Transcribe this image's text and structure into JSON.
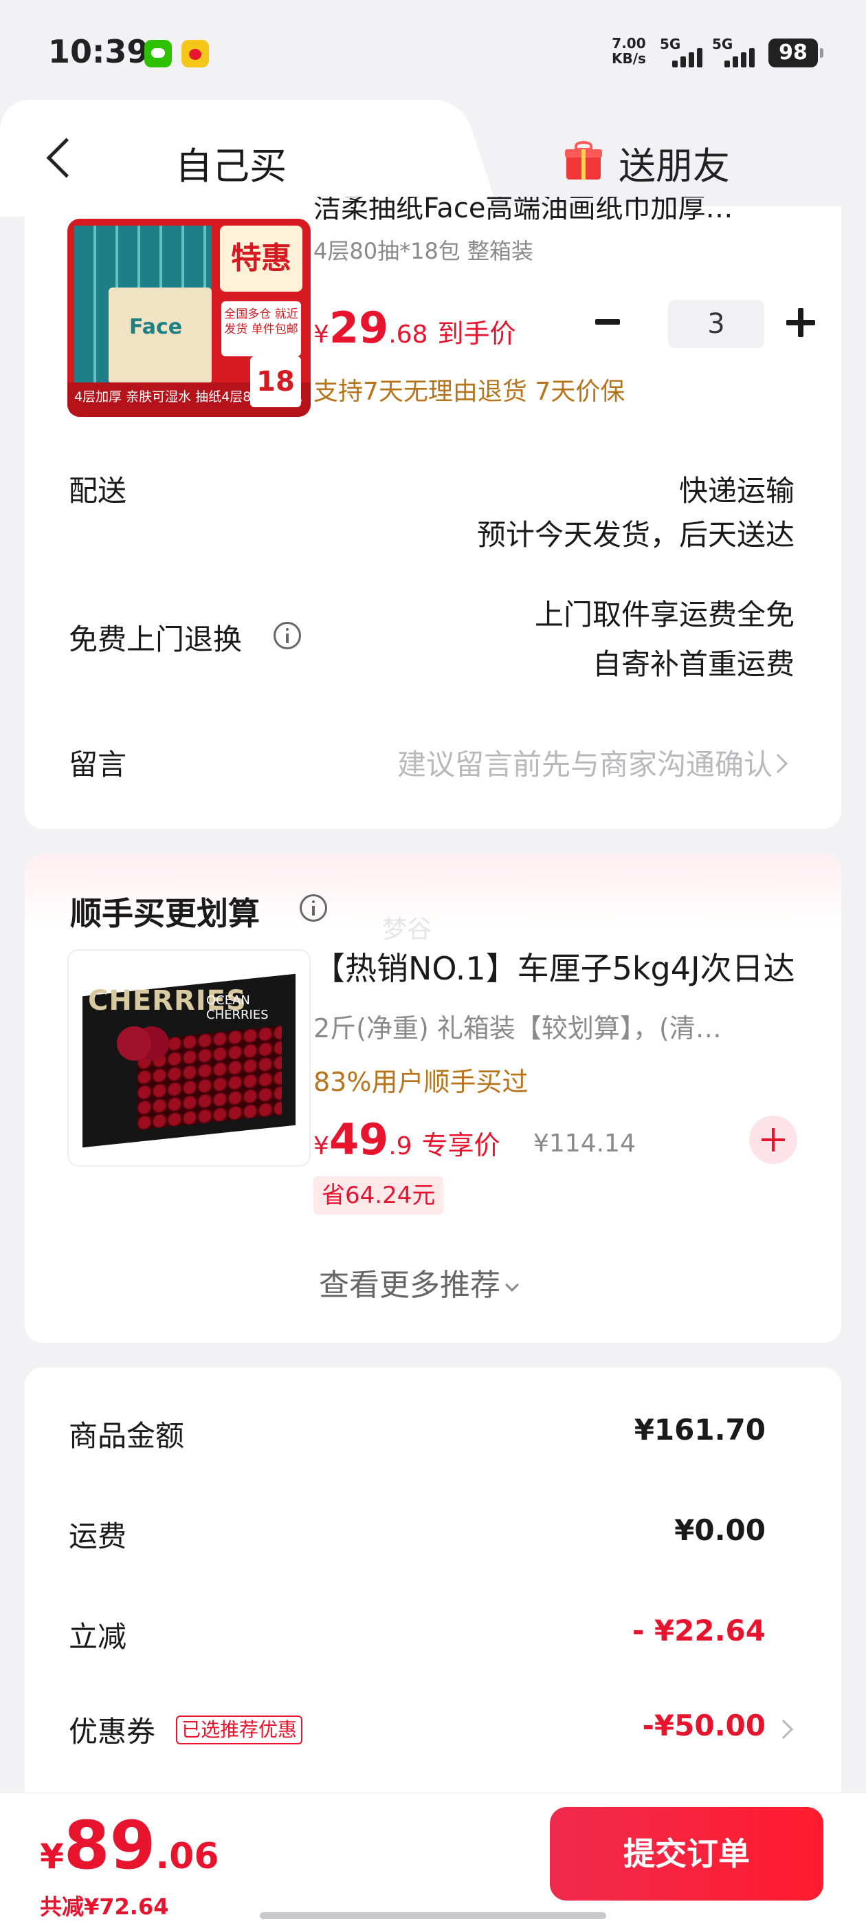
{
  "status_bar": {
    "time": "10:39",
    "net_speed_value": "7.00",
    "net_speed_unit": "KB/s",
    "signal1": "5G",
    "signal2": "5G",
    "battery": "98"
  },
  "tabs": {
    "self": "自己买",
    "gift": "送朋友"
  },
  "product": {
    "title": "洁柔抽纸Face高端油画纸巾加厚…",
    "spec": "4层80抽*18包 整箱装",
    "price_yen": "¥",
    "price_int": "29",
    "price_dec": ".68",
    "price_tag": "到手价",
    "quantity": "3",
    "support": "支持7天无理由退货 7天价保",
    "image_texts": {
      "badge": "特惠",
      "brand": "Face",
      "side": "全国多仓 就近发货 单件包邮",
      "band": "4层加厚 亲肤可湿水 抽纸4层80抽18包",
      "count": "18"
    }
  },
  "delivery": {
    "label": "配送",
    "line1": "快递运输",
    "line2": "预计今天发货，后天送达"
  },
  "return": {
    "label": "免费上门退换",
    "line1": "上门取件享运费全免",
    "line2": "自寄补首重运费"
  },
  "message": {
    "label": "留言",
    "placeholder": "建议留言前先与商家沟通确认"
  },
  "recommend": {
    "section_title": "顺手买更划算",
    "watermark": "梦谷",
    "title": "【热销NO.1】车厘子5kg4J次日达",
    "spec": "2斤(净重) 礼箱装【较划算】，(清…",
    "hint": "83%用户顺手买过",
    "price_yen": "¥",
    "price_int": "49",
    "price_dec": ".9",
    "price_tag": "专享价",
    "original_price": "¥114.14",
    "save": "省64.24元",
    "more": "查看更多推荐",
    "image_texts": {
      "left": "CHERRIES",
      "right": "OCEAN CHERRIES"
    }
  },
  "summary": {
    "goods_label": "商品金额",
    "goods_value": "¥161.70",
    "shipping_label": "运费",
    "shipping_value": "¥0.00",
    "discount_label": "立减",
    "discount_value": "- ¥22.64",
    "coupon_label": "优惠券",
    "coupon_badge": "已选推荐优惠",
    "coupon_value": "-¥50.00"
  },
  "bottom": {
    "total_yen": "¥",
    "total_int": "89",
    "total_dec": ".06",
    "total_save": "共减¥72.64",
    "submit": "提交订单"
  },
  "colors": {
    "accent": "#e8132d",
    "warning": "#b8741a",
    "background": "#f2f2f4"
  }
}
